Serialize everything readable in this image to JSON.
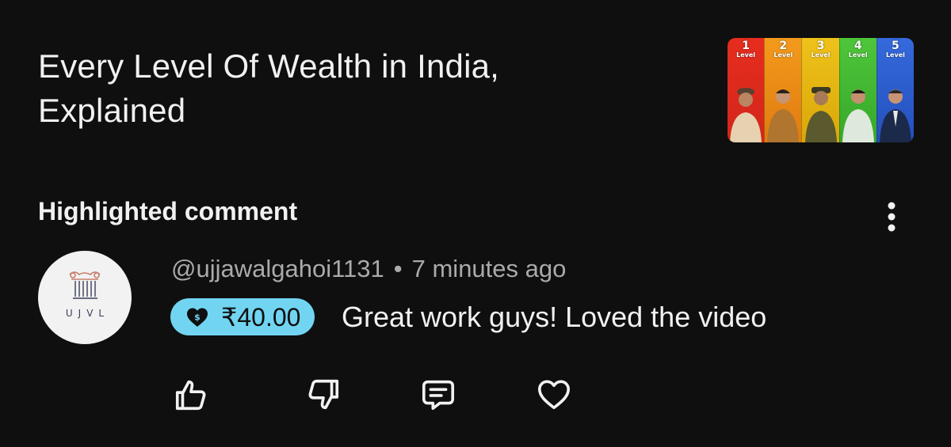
{
  "video": {
    "title_line1": "Every Level Of Wealth in India,",
    "title_line2": "Explained",
    "thumbnail": {
      "levels": [
        {
          "num": "1",
          "word": "Level",
          "color": "#e52d1f"
        },
        {
          "num": "2",
          "word": "Level",
          "color": "#f08a14"
        },
        {
          "num": "3",
          "word": "Level",
          "color": "#e3b40c"
        },
        {
          "num": "4",
          "word": "Level",
          "color": "#43b832"
        },
        {
          "num": "5",
          "word": "Level",
          "color": "#2f62d6"
        }
      ]
    }
  },
  "section": {
    "heading": "Highlighted comment",
    "more_icon": "more-vertical-icon"
  },
  "comment": {
    "avatar_text": "UJVL",
    "author": "@ujjawalgahoi1131",
    "separator": "•",
    "time": "7 minutes ago",
    "super_thanks": {
      "amount": "₹40.00",
      "icon": "super-thanks-heart-dollar-icon",
      "color": "#71d5f2"
    },
    "text": "Great work guys! Loved the video"
  },
  "actions": [
    {
      "icon": "thumbs-up-icon"
    },
    {
      "icon": "thumbs-down-icon"
    },
    {
      "icon": "reply-icon"
    },
    {
      "icon": "heart-icon"
    }
  ]
}
